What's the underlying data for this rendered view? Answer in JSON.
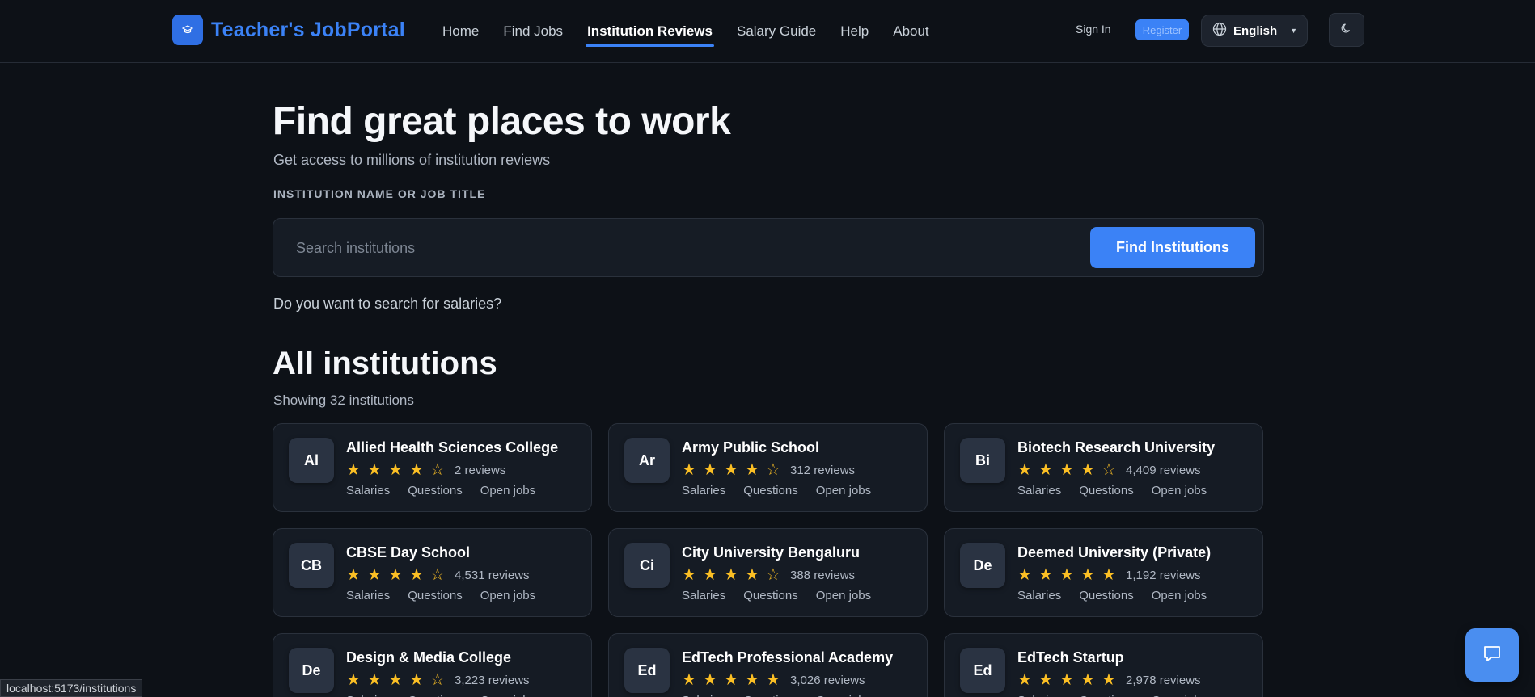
{
  "header": {
    "brand": "Teacher's JobPortal",
    "nav": [
      {
        "label": "Home",
        "active": false
      },
      {
        "label": "Find Jobs",
        "active": false
      },
      {
        "label": "Institution Reviews",
        "active": true
      },
      {
        "label": "Salary Guide",
        "active": false
      },
      {
        "label": "Help",
        "active": false
      },
      {
        "label": "About",
        "active": false
      }
    ],
    "sign_in": "Sign In",
    "register": "Register",
    "language": "English"
  },
  "hero": {
    "title": "Find great places to work",
    "subtitle": "Get access to millions of institution reviews",
    "field_label": "INSTITUTION NAME OR JOB TITLE",
    "search_placeholder": "Search institutions",
    "search_value": "",
    "search_button": "Find Institutions",
    "salary_link": "Do you want to search for salaries?"
  },
  "section": {
    "title": "All institutions",
    "count": "Showing 32 institutions"
  },
  "institutions": [
    {
      "initials": "Al",
      "name": "Allied Health Sciences College",
      "rating": 4,
      "reviews": "2 reviews",
      "links": [
        "Salaries",
        "Questions",
        "Open jobs"
      ]
    },
    {
      "initials": "Ar",
      "name": "Army Public School",
      "rating": 4,
      "reviews": "312 reviews",
      "links": [
        "Salaries",
        "Questions",
        "Open jobs"
      ]
    },
    {
      "initials": "Bi",
      "name": "Biotech Research University",
      "rating": 4,
      "reviews": "4,409 reviews",
      "links": [
        "Salaries",
        "Questions",
        "Open jobs"
      ]
    },
    {
      "initials": "CB",
      "name": "CBSE Day School",
      "rating": 4,
      "reviews": "4,531 reviews",
      "links": [
        "Salaries",
        "Questions",
        "Open jobs"
      ]
    },
    {
      "initials": "Ci",
      "name": "City University Bengaluru",
      "rating": 4,
      "reviews": "388 reviews",
      "links": [
        "Salaries",
        "Questions",
        "Open jobs"
      ]
    },
    {
      "initials": "De",
      "name": "Deemed University (Private)",
      "rating": 5,
      "reviews": "1,192 reviews",
      "links": [
        "Salaries",
        "Questions",
        "Open jobs"
      ]
    },
    {
      "initials": "De",
      "name": "Design & Media College",
      "rating": 4,
      "reviews": "3,223 reviews",
      "links": [
        "Salaries",
        "Questions",
        "Open jobs"
      ]
    },
    {
      "initials": "Ed",
      "name": "EdTech Professional Academy",
      "rating": 5,
      "reviews": "3,026 reviews",
      "links": [
        "Salaries",
        "Questions",
        "Open jobs"
      ]
    },
    {
      "initials": "Ed",
      "name": "EdTech Startup",
      "rating": 5,
      "reviews": "2,978 reviews",
      "links": [
        "Salaries",
        "Questions",
        "Open jobs"
      ]
    }
  ],
  "status_bar": "localhost:5173/institutions",
  "icons": {
    "brand": "graduation-cap-icon",
    "language": "globe-icon",
    "theme": "moon-icon",
    "chat": "chat-bubble-icon",
    "star": "star-icon"
  },
  "colors": {
    "accent": "#3b82f6",
    "star": "#fbbf24",
    "background": "#0d1117",
    "card": "#151b24"
  }
}
